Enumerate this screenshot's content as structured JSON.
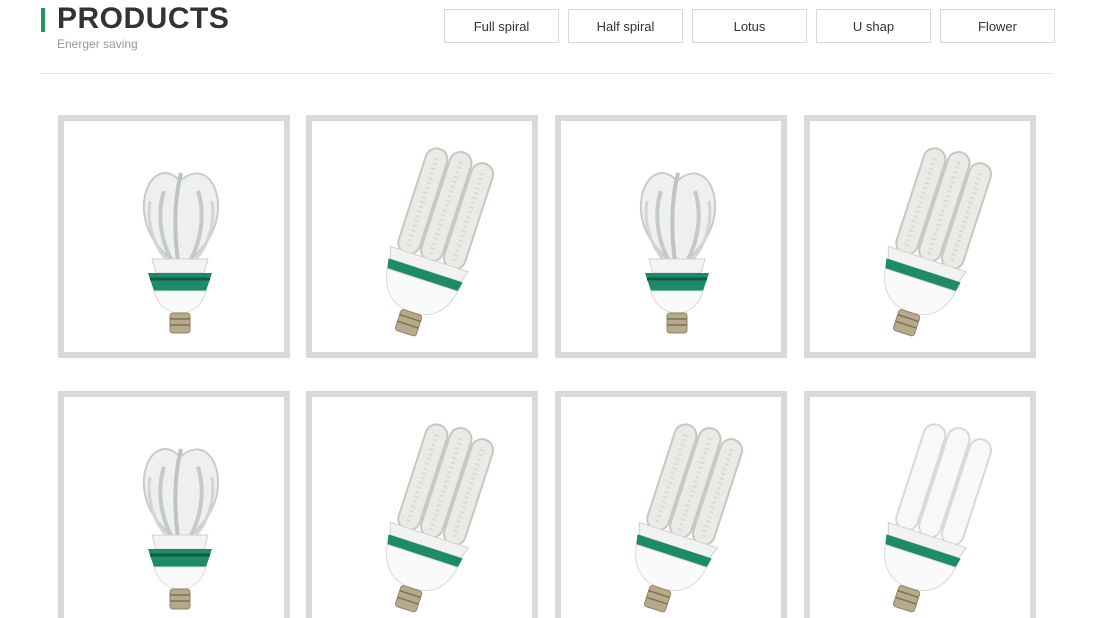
{
  "header": {
    "title": "PRODUCTS",
    "subtitle": "Energer saving",
    "accent_color": "#1f9a5a"
  },
  "tabs": [
    {
      "label": "Full spiral"
    },
    {
      "label": "Half spiral"
    },
    {
      "label": "Lotus"
    },
    {
      "label": "U shap"
    },
    {
      "label": "Flower"
    }
  ],
  "products": [
    {
      "shape": "lotus",
      "image": "lotus-led-bulb-image"
    },
    {
      "shape": "u-3",
      "image": "u-shape-led-bulb-image"
    },
    {
      "shape": "lotus",
      "image": "lotus-led-bulb-image"
    },
    {
      "shape": "u-3",
      "image": "u-shape-led-bulb-image"
    },
    {
      "shape": "lotus",
      "image": "lotus-led-bulb-image"
    },
    {
      "shape": "u-3",
      "image": "u-shape-led-bulb-image"
    },
    {
      "shape": "u-3",
      "image": "u-shape-led-bulb-image"
    },
    {
      "shape": "u-3-white",
      "image": "u-shape-cfl-bulb-image"
    }
  ]
}
